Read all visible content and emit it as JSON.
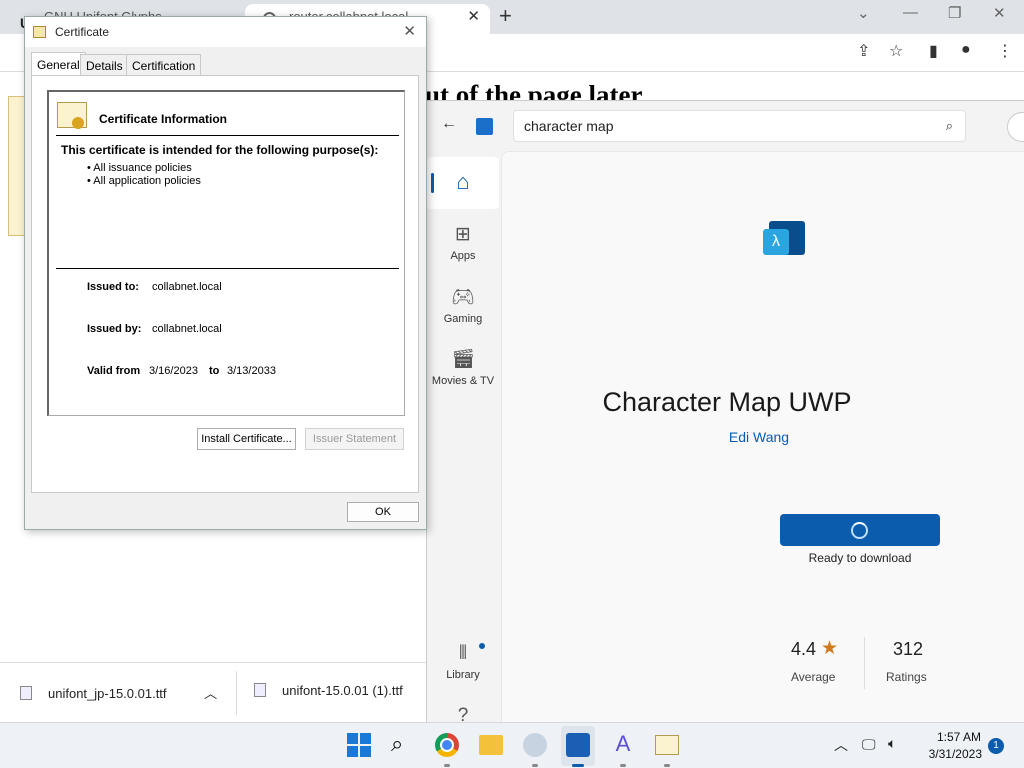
{
  "browser": {
    "tabs": [
      {
        "label": "GNU Unifont Glyphs",
        "favicon": "Uf"
      },
      {
        "label": "router.collabnet.local"
      }
    ],
    "page_headline": "ut of the page later",
    "downloads": [
      {
        "name": "unifont_jp-15.0.01.ttf"
      },
      {
        "name": "unifont-15.0.01 (1).ttf"
      }
    ]
  },
  "store": {
    "search_value": "character map",
    "nav": {
      "apps": "Apps",
      "gaming": "Gaming",
      "movies": "Movies & TV",
      "library": "Library"
    },
    "app": {
      "title": "Character Map UWP",
      "developer": "Edi Wang",
      "icon_glyph": "λ",
      "status": "Ready to download",
      "rating": "4.4",
      "rating_label": "Average",
      "ratings_count": "312",
      "ratings_label": "Ratings"
    },
    "colors": {
      "accent": "#0b5cad",
      "star": "#d27b1c"
    }
  },
  "certificate": {
    "window_title": "Certificate",
    "tabs": [
      "General",
      "Details",
      "Certification Path"
    ],
    "heading": "Certificate Information",
    "purpose_heading": "This certificate is intended for the following purpose(s):",
    "purposes": [
      "• All issuance policies",
      "• All application policies"
    ],
    "issued_to_label": "Issued to:",
    "issued_to": "collabnet.local",
    "issued_by_label": "Issued by:",
    "issued_by": "collabnet.local",
    "valid_from_label": "Valid from",
    "valid_from": "3/16/2023",
    "to_label": "to",
    "valid_to": "3/13/2033",
    "install_button": "Install Certificate...",
    "issuer_button": "Issuer Statement",
    "ok_button": "OK"
  },
  "taskbar": {
    "time": "1:57 AM",
    "date": "3/31/2023",
    "notifications": "1"
  }
}
